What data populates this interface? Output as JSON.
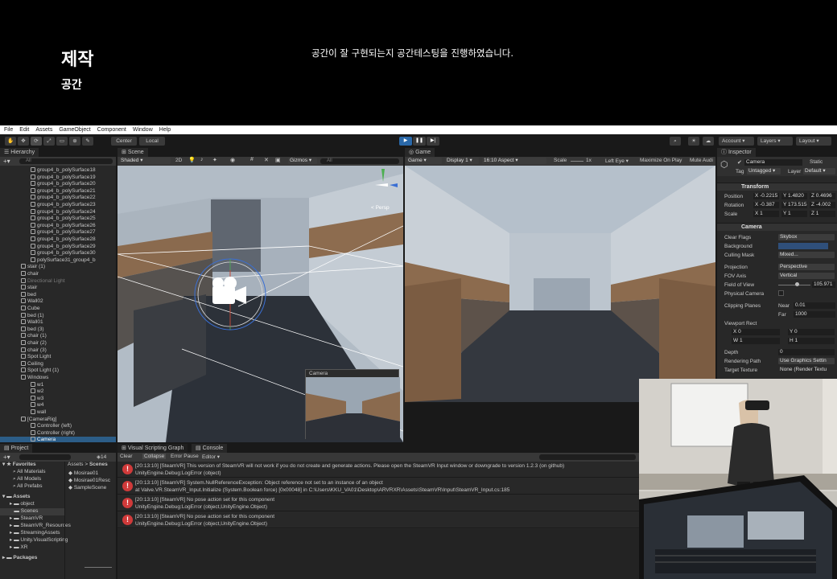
{
  "slide": {
    "title": "제작",
    "subtitle": "공간",
    "description": "공간이 잘 구현되는지 공간테스팅을  진행하였습니다."
  },
  "menu": [
    "File",
    "Edit",
    "Assets",
    "GameObject",
    "Component",
    "Window",
    "Help"
  ],
  "toolbar": {
    "center_label": "Center",
    "local_label": "Local",
    "account_label": "Account",
    "layers_label": "Layers",
    "layout_label": "Layout"
  },
  "hierarchy": {
    "tab": "Hierarchy",
    "search_placeholder": "All",
    "items": [
      {
        "label": "group4_b_polySurface18",
        "indent": 2,
        "state": ""
      },
      {
        "label": "group4_b_polySurface19",
        "indent": 2,
        "state": ""
      },
      {
        "label": "group4_b_polySurface20",
        "indent": 2,
        "state": ""
      },
      {
        "label": "group4_b_polySurface21",
        "indent": 2,
        "state": ""
      },
      {
        "label": "group4_b_polySurface22",
        "indent": 2,
        "state": ""
      },
      {
        "label": "group4_b_polySurface23",
        "indent": 2,
        "state": ""
      },
      {
        "label": "group4_b_polySurface24",
        "indent": 2,
        "state": ""
      },
      {
        "label": "group4_b_polySurface25",
        "indent": 2,
        "state": ""
      },
      {
        "label": "group4_b_polySurface26",
        "indent": 2,
        "state": ""
      },
      {
        "label": "group4_b_polySurface27",
        "indent": 2,
        "state": ""
      },
      {
        "label": "group4_b_polySurface28",
        "indent": 2,
        "state": ""
      },
      {
        "label": "group4_b_polySurface29",
        "indent": 2,
        "state": ""
      },
      {
        "label": "group4_b_polySurface30",
        "indent": 2,
        "state": ""
      },
      {
        "label": "polySurface31_group4_b",
        "indent": 2,
        "state": ""
      },
      {
        "label": "stair (1)",
        "indent": 1,
        "state": ""
      },
      {
        "label": "chair",
        "indent": 1,
        "state": ""
      },
      {
        "label": "Directional Light",
        "indent": 1,
        "state": "dim"
      },
      {
        "label": "stair",
        "indent": 1,
        "state": ""
      },
      {
        "label": "bed",
        "indent": 1,
        "state": ""
      },
      {
        "label": "Wall02",
        "indent": 1,
        "state": ""
      },
      {
        "label": "Cube",
        "indent": 1,
        "state": ""
      },
      {
        "label": "bed (1)",
        "indent": 1,
        "state": ""
      },
      {
        "label": "Wall01",
        "indent": 1,
        "state": ""
      },
      {
        "label": "bed (3)",
        "indent": 1,
        "state": ""
      },
      {
        "label": "chair (1)",
        "indent": 1,
        "state": ""
      },
      {
        "label": "chair (2)",
        "indent": 1,
        "state": ""
      },
      {
        "label": "chair (3)",
        "indent": 1,
        "state": ""
      },
      {
        "label": "Spot Light",
        "indent": 1,
        "state": ""
      },
      {
        "label": "Ceiling",
        "indent": 1,
        "state": ""
      },
      {
        "label": "Spot Light (1)",
        "indent": 1,
        "state": ""
      },
      {
        "label": "Windows",
        "indent": 1,
        "state": ""
      },
      {
        "label": "w1",
        "indent": 2,
        "state": ""
      },
      {
        "label": "w2",
        "indent": 2,
        "state": ""
      },
      {
        "label": "w3",
        "indent": 2,
        "state": ""
      },
      {
        "label": "w4",
        "indent": 2,
        "state": ""
      },
      {
        "label": "wall",
        "indent": 2,
        "state": ""
      },
      {
        "label": "[CameraRig]",
        "indent": 1,
        "state": ""
      },
      {
        "label": "Controller (left)",
        "indent": 2,
        "state": ""
      },
      {
        "label": "Controller (right)",
        "indent": 2,
        "state": ""
      },
      {
        "label": "Camera",
        "indent": 2,
        "state": "sel"
      }
    ]
  },
  "scene": {
    "tab": "Scene",
    "shading": "Shaded",
    "mode_2d": "2D",
    "gizmos": "Gizmos",
    "search_placeholder": "All",
    "persp_label": "< Persp",
    "camera_preview_label": "Camera"
  },
  "game": {
    "tab": "Game",
    "mode": "Game",
    "display": "Display 1",
    "aspect": "16:10 Aspect",
    "scale_label": "Scale",
    "scale_value": "1x",
    "eye": "Left Eye",
    "maximize": "Maximize On Play",
    "mute": "Mute Audi"
  },
  "inspector": {
    "tab": "Inspector",
    "object_name": "Camera",
    "static_label": "Static",
    "tag_label": "Tag",
    "tag_value": "Untagged",
    "layer_label": "Layer",
    "layer_value": "Default",
    "transform": {
      "header": "Transform",
      "position_label": "Position",
      "rotation_label": "Rotation",
      "scale_label": "Scale",
      "position": [
        "X -0.2215",
        "Y 1.4820",
        "Z 0.4696"
      ],
      "rotation": [
        "X -0.387",
        "Y 173.515",
        "Z -4.002"
      ],
      "scale": [
        "X 1",
        "Y 1",
        "Z 1"
      ]
    },
    "camera": {
      "header": "Camera",
      "clear_flags_label": "Clear Flags",
      "clear_flags_value": "Skybox",
      "background_label": "Background",
      "background_color": "#2f4f7a",
      "culling_label": "Culling Mask",
      "culling_value": "Mixed...",
      "projection_label": "Projection",
      "projection_value": "Perspective",
      "fov_axis_label": "FOV Axis",
      "fov_axis_value": "Vertical",
      "fov_label": "Field of View",
      "fov_value": "105.971",
      "physical_label": "Physical Camera",
      "clipping_label": "Clipping Planes",
      "near_label": "Near",
      "near_value": "0.01",
      "far_label": "Far",
      "far_value": "1000",
      "viewport_label": "Viewport Rect",
      "vx": "X 0",
      "vy": "Y 0",
      "vw": "W 1",
      "vh": "H 1",
      "depth_label": "Depth",
      "depth_value": "0",
      "rendering_label": "Rendering Path",
      "rendering_value": "Use Graphics Settin",
      "target_label": "Target Texture",
      "target_value": "None (Render Textu"
    }
  },
  "project": {
    "tab": "Project",
    "count": "14",
    "favorites_header": "Favorites",
    "favorites": [
      "All Materials",
      "All Models",
      "All Prefabs"
    ],
    "assets_header": "Assets",
    "asset_folders": [
      "object",
      "Scenes",
      "SteamVR",
      "SteamVR_Resources",
      "StreamingAssets",
      "Unity.VisualScripting",
      "XR"
    ],
    "packages_header": "Packages",
    "breadcrumb_root": "Assets",
    "breadcrumb_current": "Scenes",
    "scene_files": [
      "Mosirae01",
      "Mosirae01Resc",
      "SampleScene"
    ]
  },
  "console": {
    "tab_visual": "Visual Scripting Graph",
    "tab_console": "Console",
    "clear": "Clear",
    "collapse": "Collapse",
    "error_pause": "Error Pause",
    "editor": "Editor",
    "messages": [
      {
        "l1": "[20:13:10] [SteamVR] This version of SteamVR will not work if you do not create and generate actions. Please open the SteamVR Input window or downgrade to version 1.2.3 (on github)",
        "l2": "UnityEngine.Debug:LogError (object)"
      },
      {
        "l1": "[20:13:10] [SteamVR] System.NullReferenceException: Object reference not set to an instance of an object",
        "l2": "at Valve.VR.SteamVR_Input.Initialize (System.Boolean force) [0x00048] in C:\\Users\\KKU_VA01\\Desktop\\ARVRXR\\Assets\\SteamVR\\Input\\SteamVR_Input.cs:185"
      },
      {
        "l1": "[20:13:10] [SteamVR] No pose action set for this component",
        "l2": "UnityEngine.Debug:LogError (object,UnityEngine.Object)"
      },
      {
        "l1": "[20:13:10] [SteamVR] No pose action set for this component",
        "l2": "UnityEngine.Debug:LogError (object,UnityEngine.Object)"
      }
    ]
  }
}
